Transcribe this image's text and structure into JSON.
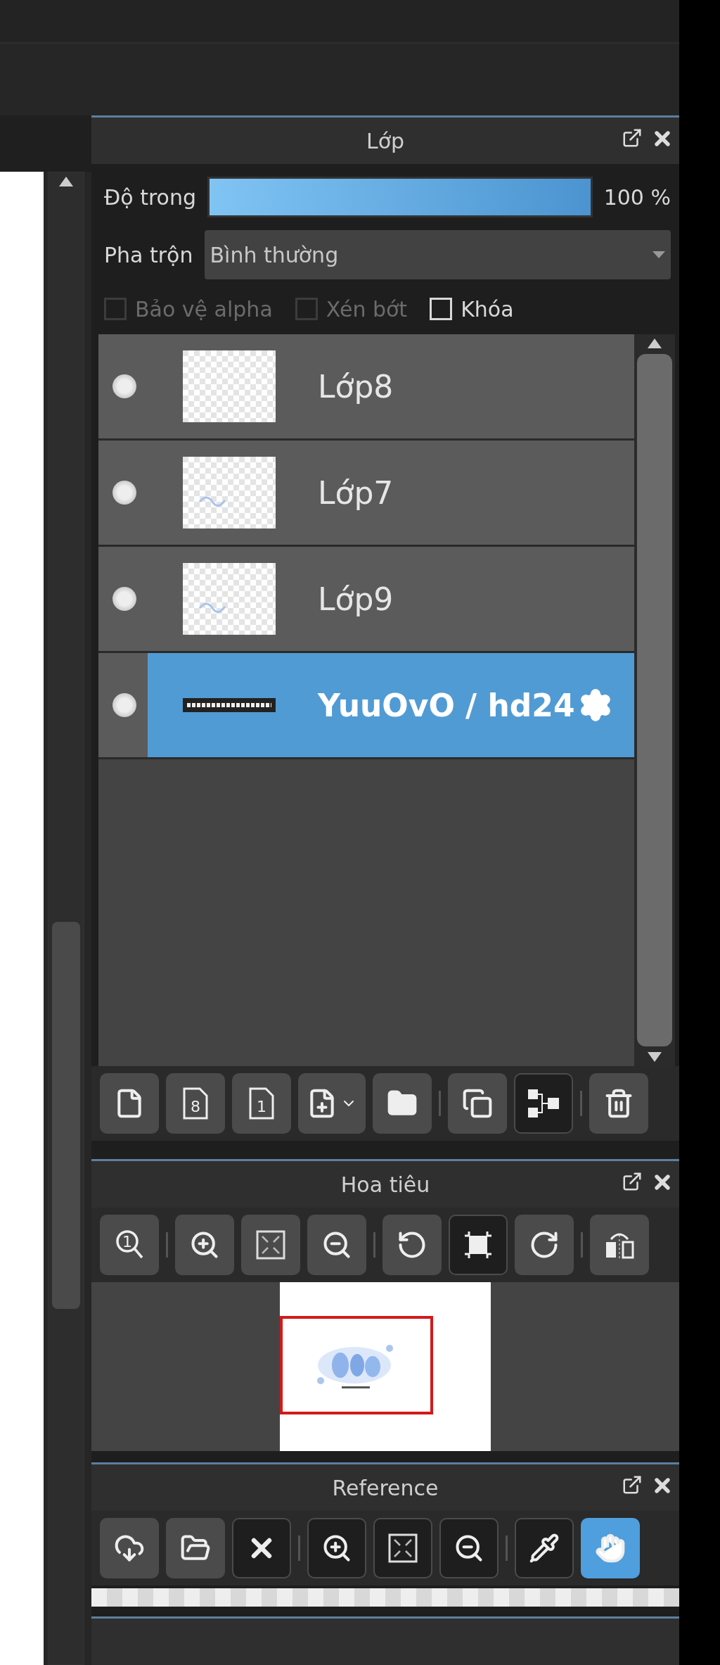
{
  "layers_panel": {
    "title": "Lớp",
    "opacity": {
      "label": "Độ trong",
      "level": 1,
      "reading": "100 %"
    },
    "blend": {
      "label": "Pha trộn",
      "value": "Bình thường"
    },
    "options": [
      {
        "label": "Bảo vệ alpha",
        "checked": false,
        "disabled": true
      },
      {
        "label": "Xén bớt",
        "checked": false,
        "disabled": true
      },
      {
        "label": "Khóa",
        "checked": false,
        "disabled": false
      }
    ],
    "layers": [
      {
        "name": "Lớp8",
        "selected": false
      },
      {
        "name": "Lớp7",
        "selected": false
      },
      {
        "name": "Lớp9",
        "selected": false
      },
      {
        "name": "YuuOvO / hd24",
        "selected": true
      }
    ],
    "toolbar": [
      {
        "kind": "new-layer",
        "disabled": false
      },
      {
        "kind": "numbered-layer",
        "glyph": "8",
        "disabled": false
      },
      {
        "kind": "numbered-layer",
        "glyph": "1",
        "disabled": false
      },
      {
        "kind": "add-menu",
        "disabled": false
      },
      {
        "kind": "folder",
        "disabled": false
      },
      {
        "kind": "separator"
      },
      {
        "kind": "duplicate",
        "disabled": false
      },
      {
        "kind": "merge",
        "disabled": true
      },
      {
        "kind": "separator"
      },
      {
        "kind": "trash",
        "disabled": false
      }
    ]
  },
  "navigator_panel": {
    "title": "Hoa tiêu",
    "toolbar": [
      {
        "kind": "zoom-actual",
        "glyph": "1",
        "disabled": false
      },
      {
        "kind": "separator"
      },
      {
        "kind": "zoom-in",
        "disabled": false
      },
      {
        "kind": "fit",
        "disabled": false
      },
      {
        "kind": "zoom-out",
        "disabled": false
      },
      {
        "kind": "separator"
      },
      {
        "kind": "rotate-left",
        "disabled": false
      },
      {
        "kind": "reset-view",
        "disabled": true
      },
      {
        "kind": "rotate-right",
        "disabled": false
      },
      {
        "kind": "separator"
      },
      {
        "kind": "flip",
        "disabled": false
      }
    ]
  },
  "reference_panel": {
    "title": "Reference",
    "toolbar": [
      {
        "kind": "cloud-download",
        "disabled": false,
        "selected": false
      },
      {
        "kind": "open-folder",
        "disabled": false,
        "selected": false
      },
      {
        "kind": "close",
        "disabled": true,
        "selected": false
      },
      {
        "kind": "separator"
      },
      {
        "kind": "zoom-in",
        "disabled": true,
        "selected": false
      },
      {
        "kind": "fit",
        "disabled": true,
        "selected": false
      },
      {
        "kind": "zoom-out",
        "disabled": true,
        "selected": false
      },
      {
        "kind": "separator"
      },
      {
        "kind": "eyedropper",
        "disabled": true,
        "selected": false
      },
      {
        "kind": "hand",
        "disabled": false,
        "selected": true
      }
    ]
  }
}
